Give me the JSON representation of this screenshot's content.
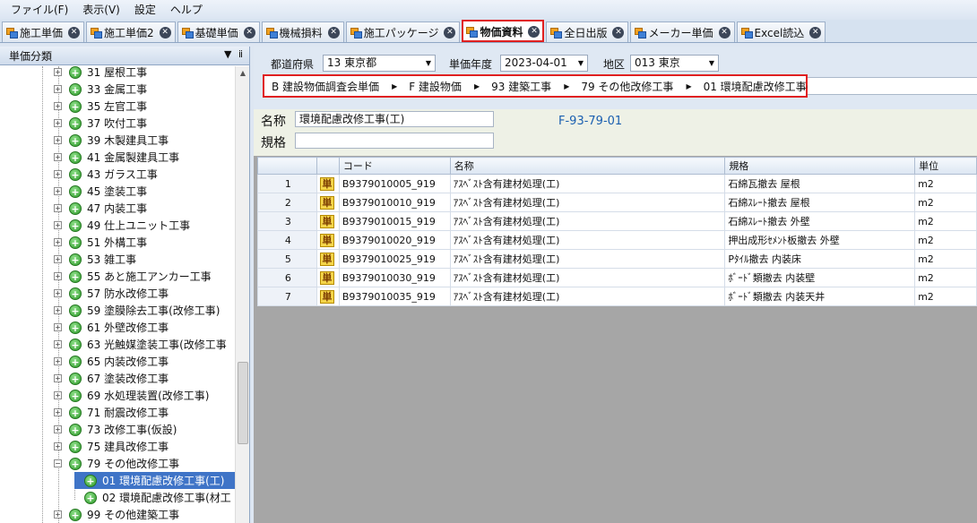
{
  "menu": [
    "ファイル(F)",
    "表示(V)",
    "設定",
    "ヘルプ"
  ],
  "tabs": [
    {
      "label": "施工単価",
      "active": false
    },
    {
      "label": "施工単価2",
      "active": false
    },
    {
      "label": "基礎単価",
      "active": false
    },
    {
      "label": "機械損料",
      "active": false
    },
    {
      "label": "施工パッケージ",
      "active": false
    },
    {
      "label": "物価資料",
      "active": true
    },
    {
      "label": "全日出版",
      "active": false
    },
    {
      "label": "メーカー単価",
      "active": false
    },
    {
      "label": "Excel読込",
      "active": false
    }
  ],
  "left_panel": {
    "title": "単価分類",
    "pin": "▼ ⅱ",
    "tree": [
      {
        "label": "31 屋根工事",
        "level": 1,
        "expander": "+"
      },
      {
        "label": "33 金属工事",
        "level": 1,
        "expander": "+"
      },
      {
        "label": "35 左官工事",
        "level": 1,
        "expander": "+"
      },
      {
        "label": "37 吹付工事",
        "level": 1,
        "expander": "+"
      },
      {
        "label": "39 木製建具工事",
        "level": 1,
        "expander": "+"
      },
      {
        "label": "41 金属製建具工事",
        "level": 1,
        "expander": "+"
      },
      {
        "label": "43 ガラス工事",
        "level": 1,
        "expander": "+"
      },
      {
        "label": "45 塗装工事",
        "level": 1,
        "expander": "+"
      },
      {
        "label": "47 内装工事",
        "level": 1,
        "expander": "+"
      },
      {
        "label": "49 仕上ユニット工事",
        "level": 1,
        "expander": "+"
      },
      {
        "label": "51 外構工事",
        "level": 1,
        "expander": "+"
      },
      {
        "label": "53 雑工事",
        "level": 1,
        "expander": "+"
      },
      {
        "label": "55 あと施工アンカー工事",
        "level": 1,
        "expander": "+"
      },
      {
        "label": "57 防水改修工事",
        "level": 1,
        "expander": "+"
      },
      {
        "label": "59 塗膜除去工事(改修工事)",
        "level": 1,
        "expander": "+"
      },
      {
        "label": "61 外壁改修工事",
        "level": 1,
        "expander": "+"
      },
      {
        "label": "63 光触媒塗装工事(改修工事",
        "level": 1,
        "expander": "+"
      },
      {
        "label": "65 内装改修工事",
        "level": 1,
        "expander": "+"
      },
      {
        "label": "67 塗装改修工事",
        "level": 1,
        "expander": "+"
      },
      {
        "label": "69 水処理装置(改修工事)",
        "level": 1,
        "expander": "+"
      },
      {
        "label": "71 耐震改修工事",
        "level": 1,
        "expander": "+"
      },
      {
        "label": "73 改修工事(仮設)",
        "level": 1,
        "expander": "+"
      },
      {
        "label": "75 建具改修工事",
        "level": 1,
        "expander": "+"
      },
      {
        "label": "79 その他改修工事",
        "level": 1,
        "expander": "−"
      },
      {
        "label": "01 環境配慮改修工事(工)",
        "level": 2,
        "expander": "",
        "selected": true
      },
      {
        "label": "02 環境配慮改修工事(材工",
        "level": 2,
        "expander": ""
      },
      {
        "label": "99 その他建築工事",
        "level": 1,
        "expander": "+"
      }
    ]
  },
  "filters": {
    "pref_label": "都道府県",
    "pref_value": "13 東京都",
    "year_label": "単価年度",
    "year_value": "2023-04-01",
    "area_label": "地区",
    "area_value": "013 東京"
  },
  "breadcrumb": [
    "B 建設物価調査会単価",
    "F 建設物価",
    "93 建築工事",
    "79 その他改修工事",
    "01 環境配慮改修工事(工)"
  ],
  "detail": {
    "name_label": "名称",
    "name_value": "環境配慮改修工事(工)",
    "spec_label": "規格",
    "spec_value": "",
    "code": "F-93-79-01"
  },
  "grid": {
    "columns": [
      "",
      "",
      "コード",
      "名称",
      "規格",
      "単位"
    ],
    "row_icon": "単",
    "rows": [
      {
        "num": "1",
        "code": "B9379010005_919",
        "name": "ｱｽﾍﾞｽﾄ含有建材処理(工)",
        "spec": "石綿瓦撤去 屋根",
        "unit": "m2"
      },
      {
        "num": "2",
        "code": "B9379010010_919",
        "name": "ｱｽﾍﾞｽﾄ含有建材処理(工)",
        "spec": "石綿ｽﾚｰﾄ撤去 屋根",
        "unit": "m2"
      },
      {
        "num": "3",
        "code": "B9379010015_919",
        "name": "ｱｽﾍﾞｽﾄ含有建材処理(工)",
        "spec": "石綿ｽﾚｰﾄ撤去 外壁",
        "unit": "m2"
      },
      {
        "num": "4",
        "code": "B9379010020_919",
        "name": "ｱｽﾍﾞｽﾄ含有建材処理(工)",
        "spec": "押出成形ｾﾒﾝﾄ板撤去 外壁",
        "unit": "m2"
      },
      {
        "num": "5",
        "code": "B9379010025_919",
        "name": "ｱｽﾍﾞｽﾄ含有建材処理(工)",
        "spec": "Pﾀｲﾙ撤去 内装床",
        "unit": "m2"
      },
      {
        "num": "6",
        "code": "B9379010030_919",
        "name": "ｱｽﾍﾞｽﾄ含有建材処理(工)",
        "spec": "ﾎﾞｰﾄﾞ類撤去 内装壁",
        "unit": "m2"
      },
      {
        "num": "7",
        "code": "B9379010035_919",
        "name": "ｱｽﾍﾞｽﾄ含有建材処理(工)",
        "spec": "ﾎﾞｰﾄﾞ類撤去 内装天井",
        "unit": "m2"
      }
    ]
  },
  "colors": {
    "accent": "#3f74c7",
    "highlight": "#e02020",
    "code_text": "#1a5fb0"
  }
}
